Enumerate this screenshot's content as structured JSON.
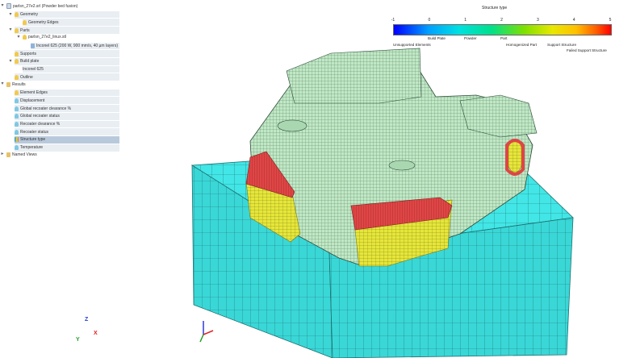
{
  "tree": [
    {
      "label": "parlsn_27e2.srl (Powder bed fusion)",
      "depth": 0,
      "icon": "doc",
      "twisty": "▾",
      "bar": false,
      "sel": false
    },
    {
      "label": "Geometry",
      "depth": 1,
      "icon": "bulb",
      "twisty": "▾",
      "bar": true,
      "sel": false
    },
    {
      "label": "Geometry Edges",
      "depth": 2,
      "icon": "bulb",
      "twisty": "",
      "bar": true,
      "sel": false
    },
    {
      "label": "Parts",
      "depth": 1,
      "icon": "bulb",
      "twisty": "▾",
      "bar": true,
      "sel": false
    },
    {
      "label": "parlsn_27e2_linux.stl",
      "depth": 2,
      "icon": "bulb",
      "twisty": "▾",
      "bar": false,
      "sel": false
    },
    {
      "label": "Inconel 625 (200 W, 900 mm/s, 40 µm layers)",
      "depth": 3,
      "icon": "cube",
      "twisty": "",
      "bar": true,
      "sel": false
    },
    {
      "label": "Supports",
      "depth": 1,
      "icon": "bulb",
      "twisty": "",
      "bar": true,
      "sel": false
    },
    {
      "label": "Build plate",
      "depth": 1,
      "icon": "bulb",
      "twisty": "▾",
      "bar": true,
      "sel": false
    },
    {
      "label": "Inconel 625",
      "depth": 2,
      "icon": "none",
      "twisty": "",
      "bar": true,
      "sel": false
    },
    {
      "label": "Outline",
      "depth": 1,
      "icon": "bulb",
      "twisty": "",
      "bar": true,
      "sel": false
    },
    {
      "label": "Results",
      "depth": 0,
      "icon": "folder",
      "twisty": "▾",
      "bar": false,
      "sel": false
    },
    {
      "label": "Element Edges",
      "depth": 1,
      "icon": "bulb",
      "twisty": "",
      "bar": true,
      "sel": false
    },
    {
      "label": "Displacement",
      "depth": 1,
      "icon": "bulbc",
      "twisty": "",
      "bar": true,
      "sel": false
    },
    {
      "label": "Global recoater clearance %",
      "depth": 1,
      "icon": "bulbc",
      "twisty": "",
      "bar": true,
      "sel": false
    },
    {
      "label": "Global recoater status",
      "depth": 1,
      "icon": "bulbc",
      "twisty": "",
      "bar": true,
      "sel": false
    },
    {
      "label": "Recoater clearance %",
      "depth": 1,
      "icon": "bulbc",
      "twisty": "",
      "bar": true,
      "sel": false
    },
    {
      "label": "Recoater status",
      "depth": 1,
      "icon": "bulbc",
      "twisty": "",
      "bar": true,
      "sel": false
    },
    {
      "label": "Structure type",
      "depth": 1,
      "icon": "pal",
      "twisty": "",
      "bar": true,
      "sel": true
    },
    {
      "label": "Temperature",
      "depth": 1,
      "icon": "bulbc",
      "twisty": "",
      "bar": true,
      "sel": false
    },
    {
      "label": "Named Views",
      "depth": 0,
      "icon": "folder",
      "twisty": "▸",
      "bar": false,
      "sel": false
    }
  ],
  "legend": {
    "title": "Structure type",
    "ticks": [
      "-1",
      "0",
      "1",
      "2",
      "3",
      "4",
      "5"
    ],
    "labels_top": [
      "Build Plate",
      "Powder",
      "Part",
      "Homogenized Part",
      "Support Structure"
    ],
    "labels_bottom": [
      "Unsupported Elements",
      "Failed Support Structure"
    ]
  },
  "triad": {
    "x": "X",
    "y": "Y",
    "z": "Z"
  },
  "colors": {
    "plate": "#42e6e6",
    "part": "#bfe8c4",
    "support": "#e6e63a",
    "failed": "#e04545",
    "mesh": "#2d4a3a",
    "selection": "#b9c9dc"
  }
}
